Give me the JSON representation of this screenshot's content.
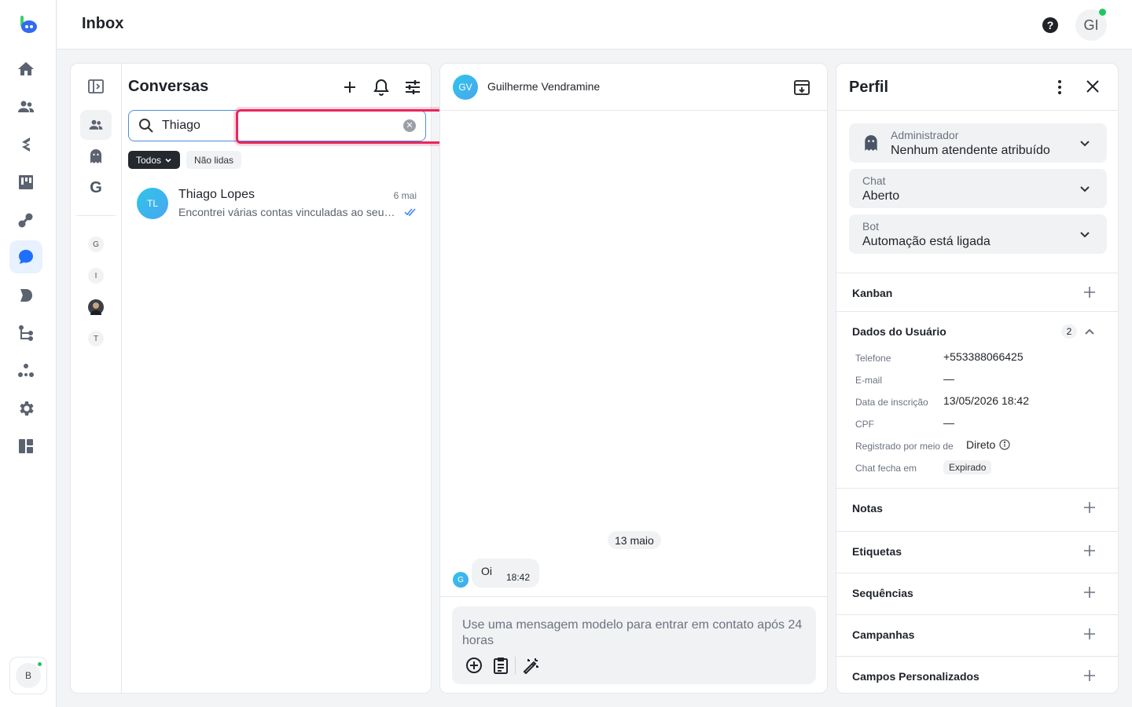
{
  "header": {
    "title": "Inbox",
    "user_initials": "GI"
  },
  "rail": {
    "bottom_user_initial": "B"
  },
  "conversations": {
    "title": "Conversas",
    "search_value": "Thiago",
    "filters": {
      "all": "Todos",
      "unread": "Não lidas"
    },
    "side_letter": "G",
    "mini_avatars": [
      "G",
      "I",
      "T"
    ],
    "items": [
      {
        "initials": "TL",
        "name": "Thiago Lopes",
        "date": "6 mai",
        "preview": "Encontrei várias contas vinculadas ao seu número de telefone"
      }
    ]
  },
  "chat": {
    "contact_initials": "GV",
    "contact_name": "Guilherme Vendramine",
    "day_separator": "13 maio",
    "message": {
      "sender_initial": "G",
      "text": "Oi",
      "time": "18:42"
    },
    "composer_placeholder": "Use uma mensagem modelo para entrar em contato após 24 horas"
  },
  "profile": {
    "title": "Perfil",
    "selects": [
      {
        "label": "Administrador",
        "value": "Nenhum atendente atribuído"
      },
      {
        "label": "Chat",
        "value": "Aberto"
      },
      {
        "label": "Bot",
        "value": "Automação está ligada"
      }
    ],
    "kanban": "Kanban",
    "user_data": {
      "title": "Dados do Usuário",
      "count": "2",
      "fields": [
        {
          "key": "Telefone",
          "value": "+553388066425"
        },
        {
          "key": "E-mail",
          "value": "—"
        },
        {
          "key": "Data de inscrição",
          "value": "13/05/2026 18:42"
        },
        {
          "key": "CPF",
          "value": "—"
        },
        {
          "key": "Registrado por meio de",
          "value": "Direto"
        },
        {
          "key": "Chat fecha em",
          "value": "Expirado"
        }
      ]
    },
    "sections": [
      "Notas",
      "Etiquetas",
      "Sequências",
      "Campanhas",
      "Campos Personalizados"
    ]
  }
}
